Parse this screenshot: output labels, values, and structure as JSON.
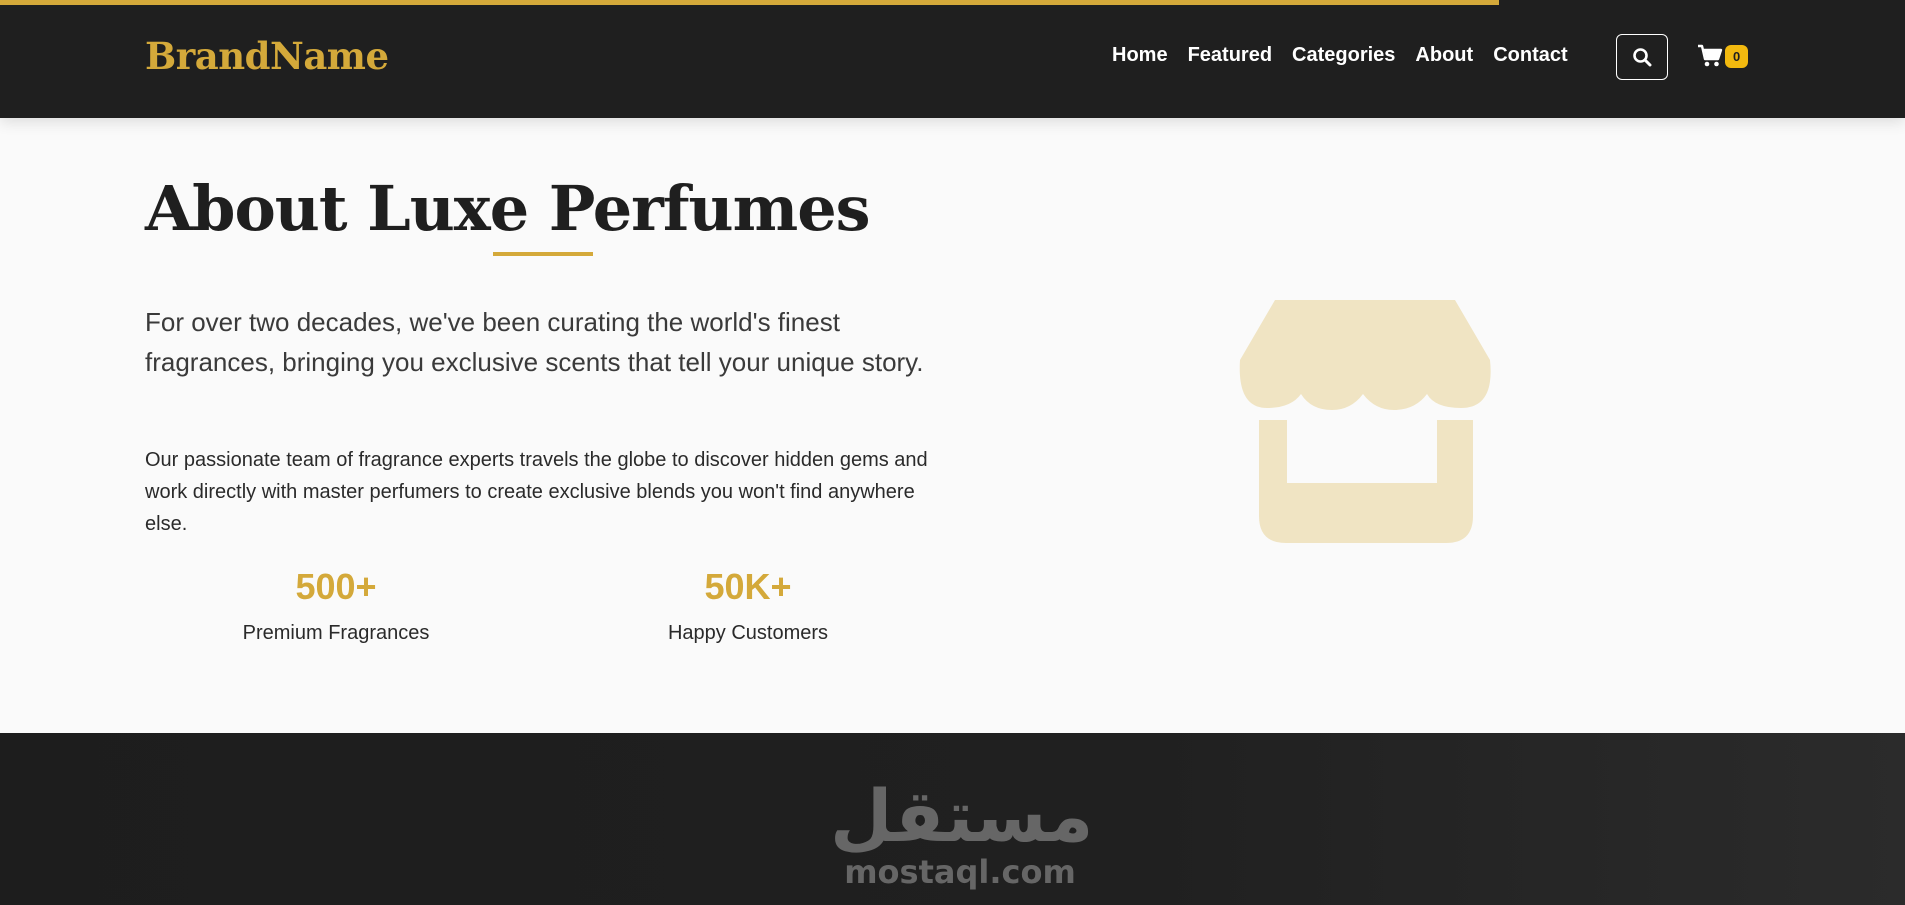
{
  "header": {
    "brand": "BrandName",
    "nav": [
      "Home",
      "Featured",
      "Categories",
      "About",
      "Contact"
    ],
    "search_icon": "search-icon",
    "cart_icon": "cart-icon",
    "cart_count": "0",
    "scroll_progress_percent": 78.7
  },
  "about": {
    "title": "About Luxe Perfumes",
    "lead": "For over two decades, we've been curating the world's finest fragrances, bringing you exclusive scents that tell your unique story.",
    "body": "Our passionate team of fragrance experts travels the globe to discover hidden gems and work directly with master perfumers to create exclusive blends you won't find anywhere else.",
    "stats": [
      {
        "value": "500+",
        "label": "Premium Fragrances"
      },
      {
        "value": "50K+",
        "label": "Happy Customers"
      }
    ],
    "illustration_icon": "store-icon"
  },
  "footer": {
    "watermark_arabic": "مستقل",
    "watermark_latin": "mostaql.com"
  },
  "colors": {
    "accent": "#d4a93a",
    "header_bg": "#1f1f1f",
    "badge": "#f2b90f",
    "illustration": "#f0e4c3"
  }
}
